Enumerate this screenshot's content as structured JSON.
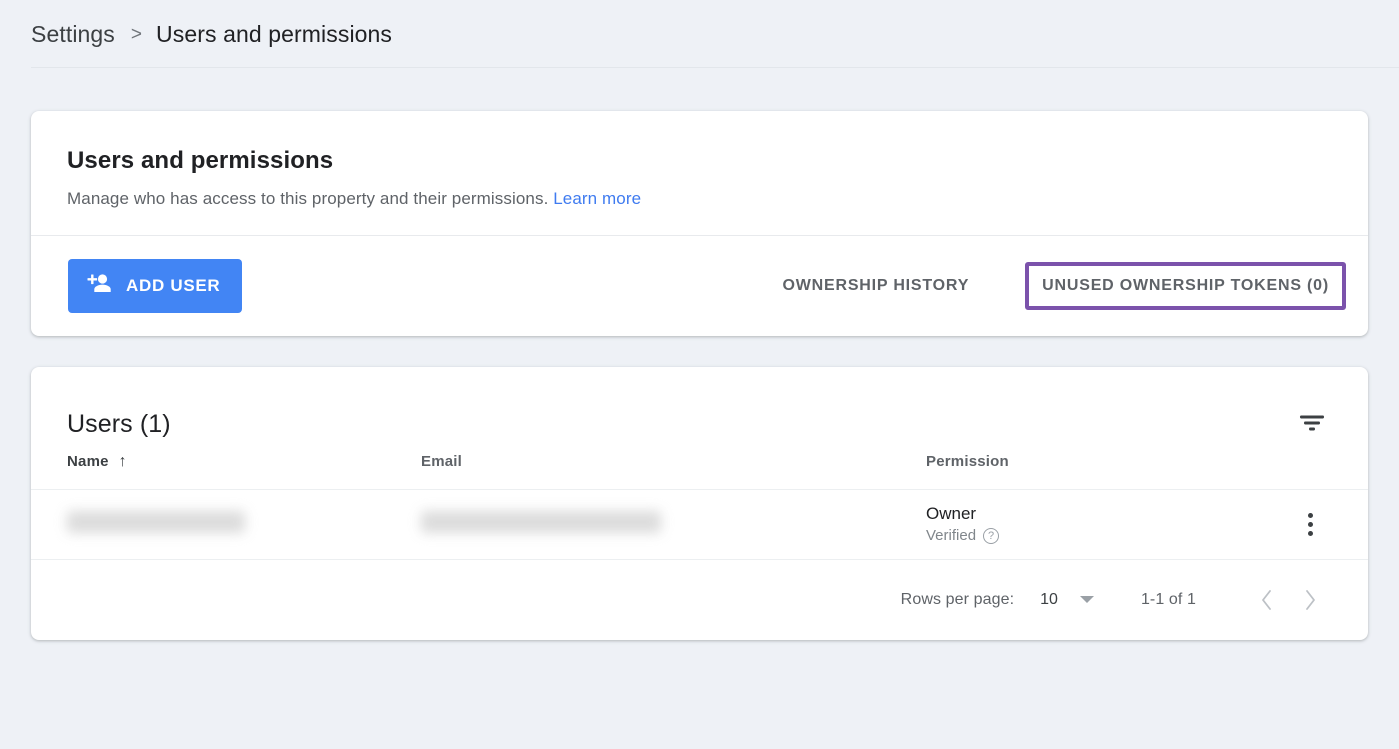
{
  "breadcrumb": {
    "root": "Settings",
    "separator": ">",
    "current": "Users and permissions"
  },
  "permissions_card": {
    "title": "Users and permissions",
    "subtitle": "Manage who has access to this property and their permissions.",
    "learn_more": "Learn more",
    "add_user_button": "ADD USER",
    "add_user_icon": "person-add-icon",
    "tabs": [
      {
        "label": "OWNERSHIP HISTORY",
        "highlighted": false
      },
      {
        "label": "UNUSED OWNERSHIP TOKENS (0)",
        "highlighted": true
      }
    ],
    "highlight_color": "#7b52ab",
    "primary_color": "#4285f4",
    "link_color": "#3f7bf0"
  },
  "users_card": {
    "title": "Users (1)",
    "filter_icon": "filter-icon",
    "columns": [
      {
        "label": "Name",
        "sorted": true,
        "sort_arrow": "↑"
      },
      {
        "label": "Email",
        "sorted": false
      },
      {
        "label": "Permission",
        "sorted": false
      }
    ],
    "rows": [
      {
        "name": "",
        "name_redacted": true,
        "email": "",
        "email_redacted": true,
        "permission": "Owner",
        "permission_status": "Verified",
        "help_icon": "help-circle-icon",
        "menu_icon": "more-vert-icon"
      }
    ],
    "pagination": {
      "rows_per_page_label": "Rows per page:",
      "rows_per_page_value": "10",
      "range": "1-1 of 1",
      "prev_icon": "chevron-left-icon",
      "next_icon": "chevron-right-icon"
    }
  }
}
